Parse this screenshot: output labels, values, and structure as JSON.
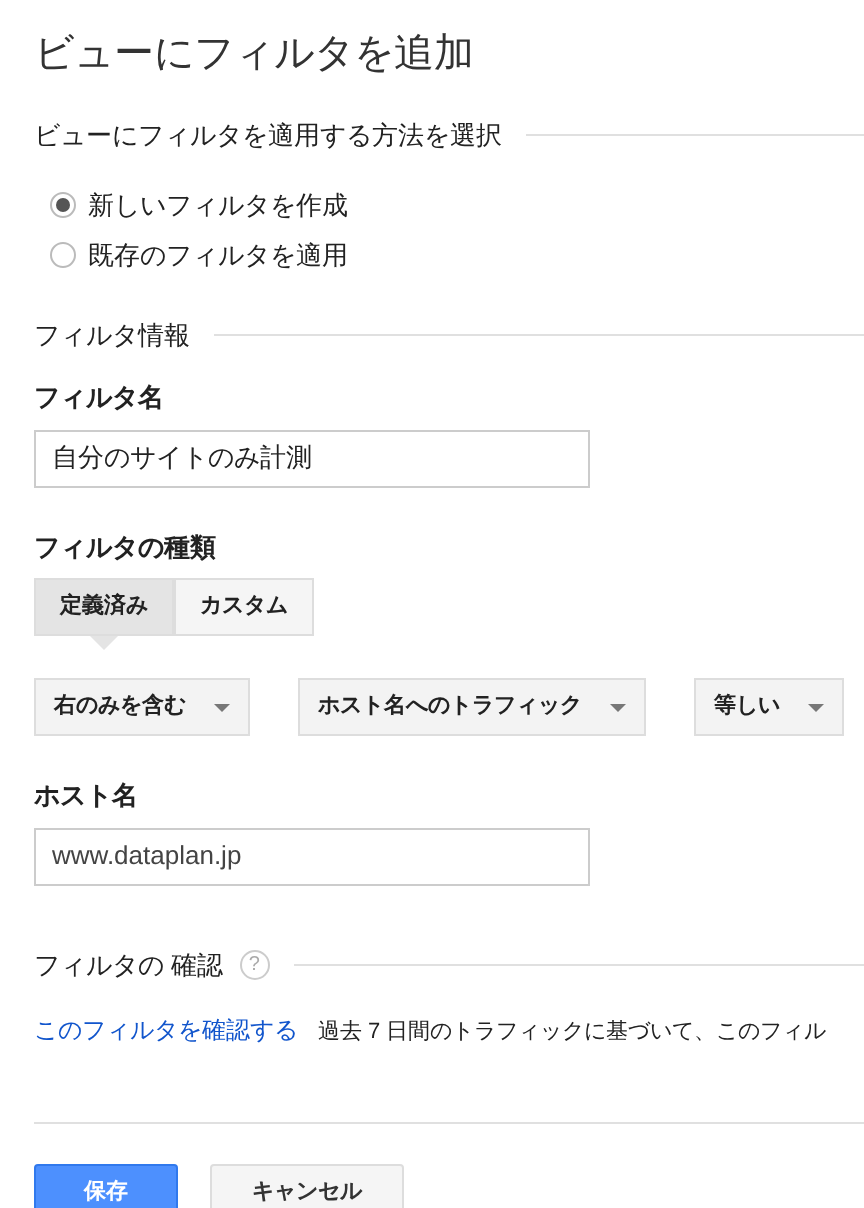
{
  "title": "ビューにフィルタを追加",
  "method_section": {
    "heading": "ビューにフィルタを適用する方法を選択",
    "options": [
      {
        "label": "新しいフィルタを作成",
        "selected": true
      },
      {
        "label": "既存のフィルタを適用",
        "selected": false
      }
    ]
  },
  "info_section": {
    "heading": "フィルタ情報",
    "name_label": "フィルタ名",
    "name_value": "自分のサイトのみ計測",
    "type_label": "フィルタの種類",
    "type_tabs": [
      {
        "label": "定義済み",
        "selected": true
      },
      {
        "label": "カスタム",
        "selected": false
      }
    ],
    "dropdowns": [
      {
        "value": "右のみを含む"
      },
      {
        "value": "ホスト名へのトラフィック"
      },
      {
        "value": "等しい"
      }
    ],
    "host_label": "ホスト名",
    "host_value": "www.dataplan.jp"
  },
  "verify_section": {
    "heading": "フィルタの 確認",
    "help": "?",
    "link": "このフィルタを確認する",
    "description": "過去 7 日間のトラフィックに基づいて、このフィル"
  },
  "buttons": [
    {
      "label": "保存",
      "kind": "primary"
    },
    {
      "label": "キャンセル",
      "kind": "secondary"
    }
  ]
}
